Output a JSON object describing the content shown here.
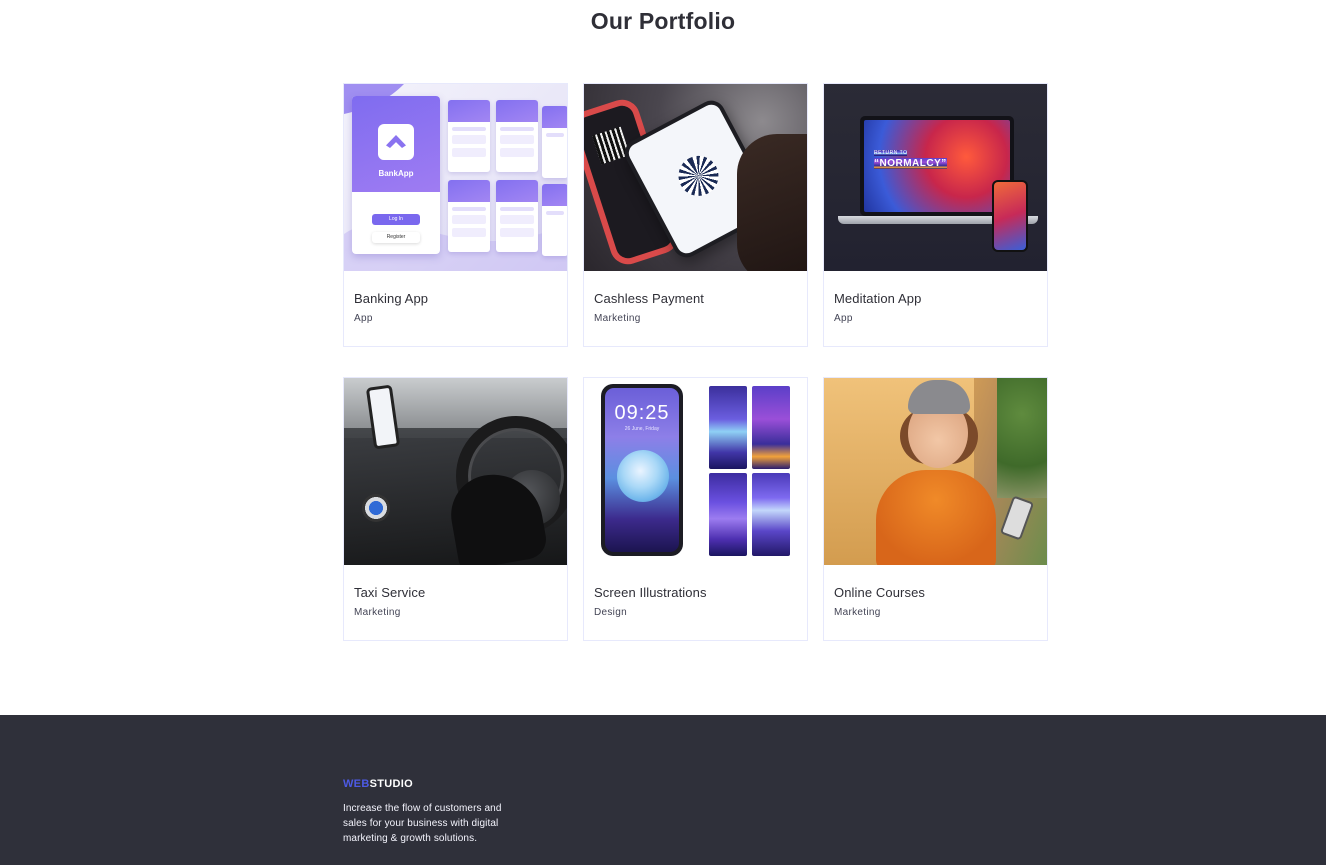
{
  "portfolio": {
    "title": "Our Portfolio",
    "items": [
      {
        "title": "Banking App",
        "category": "App"
      },
      {
        "title": "Cashless Payment",
        "category": "Marketing"
      },
      {
        "title": "Meditation App",
        "category": "App"
      },
      {
        "title": "Taxi Service",
        "category": "Marketing"
      },
      {
        "title": "Screen Illustrations",
        "category": "Design"
      },
      {
        "title": "Online Courses",
        "category": "Marketing"
      }
    ]
  },
  "images": {
    "banking": {
      "brand": "BankApp",
      "login": "Log In",
      "register": "Register"
    },
    "meditation": {
      "line1": "RETURN TO",
      "line2": "“NORMALCY”"
    },
    "screen": {
      "time": "09:25",
      "date": "26 June, Friday"
    }
  },
  "footer": {
    "logo_part1": "WEB",
    "logo_part2": "STUDIO",
    "description": "Increase the flow of customers and sales for your business with digital marketing & growth solutions."
  },
  "colors": {
    "accent": "#4d5ae5",
    "footer_bg": "#2f303a",
    "title": "#2f2f37"
  }
}
